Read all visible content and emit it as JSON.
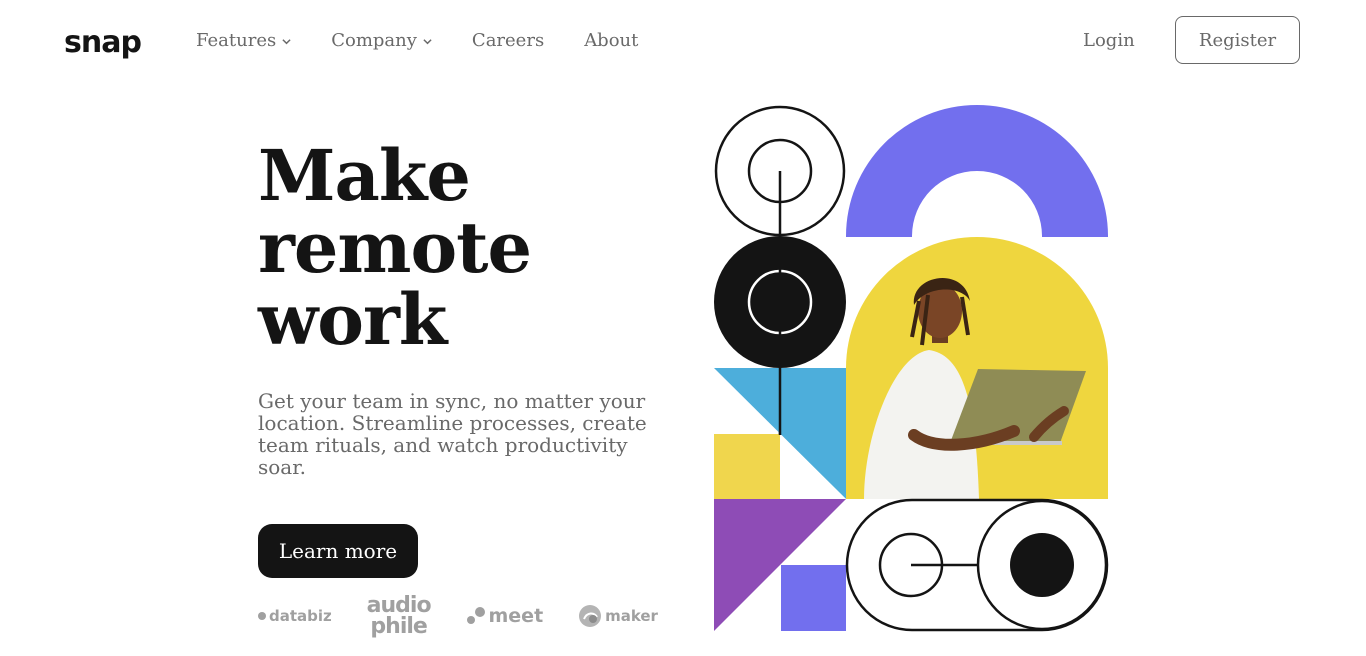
{
  "header": {
    "logo": "snap",
    "nav": [
      {
        "label": "Features",
        "has_dropdown": true
      },
      {
        "label": "Company",
        "has_dropdown": true
      },
      {
        "label": "Careers",
        "has_dropdown": false
      },
      {
        "label": "About",
        "has_dropdown": false
      }
    ],
    "login_label": "Login",
    "register_label": "Register"
  },
  "hero": {
    "headline": [
      "Make",
      "remote",
      "work"
    ],
    "subtitle": "Get your team in sync, no matter your location. Streamline processes, create team rituals, and watch productivity soar.",
    "cta_label": "Learn more"
  },
  "clients": {
    "databiz": "databiz",
    "audiophile_line1": "audio",
    "audiophile_line2": "phile",
    "meet": "meet",
    "maker": "maker"
  },
  "colors": {
    "text_dark": "#141414",
    "text_gray": "#696969",
    "violet": "#726FEE",
    "yellow": "#F0D64D",
    "blue": "#4DAEDB",
    "purple": "#8E4CB6"
  }
}
